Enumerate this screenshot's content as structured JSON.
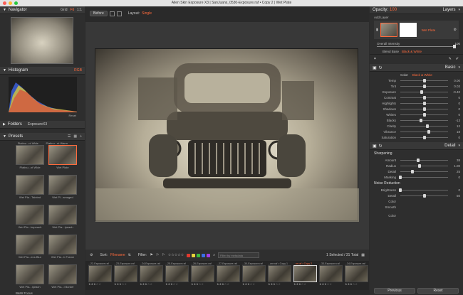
{
  "window": {
    "title": "Alien Skin Exposure X3 | SanJuans_0530-Exposure.raf • Copy 2 | Wet Plate"
  },
  "navigator": {
    "title": "Navigator",
    "grid": "Grid",
    "fit": "Fit",
    "ratio": "1:1"
  },
  "histogram": {
    "title": "Histogram",
    "mode": "RGB",
    "reset": "Reset"
  },
  "folders": {
    "title": "Folders",
    "current": "ExposureX3"
  },
  "presets": {
    "title": "Presets",
    "items": [
      {
        "label": "Platinu...nt Wide",
        "selected": false
      },
      {
        "label": "Wet Plate",
        "selected": true
      },
      {
        "label": "Wet Pla...Tainted",
        "selected": false
      },
      {
        "label": "Wet Pl...amaged",
        "selected": false
      },
      {
        "label": "Wet Pla...Impeach",
        "selected": false
      },
      {
        "label": "Wet Pla...Ipeach",
        "selected": false
      },
      {
        "label": "Wet Pla...ens Blur",
        "selected": false
      },
      {
        "label": "Wet Pla...h Frame",
        "selected": false
      },
      {
        "label": "Wet Pla...Ipeach",
        "selected": false
      },
      {
        "label": "Wet Pla...l Border",
        "selected": false
      }
    ],
    "top_labels": [
      "Platinu...nt Wide",
      "Platinu...nt Warm"
    ],
    "group": "B&W Focus"
  },
  "toolbar": {
    "before": "Before",
    "layout_label": "Layout:",
    "layout_value": "Single"
  },
  "filterbar": {
    "sort_label": "Sort:",
    "sort_value": "Filename",
    "filter_label": "Filter:",
    "search_placeholder": "Filter by metadata",
    "selection": "1 Selected / 31 Total",
    "colors": [
      "#e23a2e",
      "#e8d43a",
      "#3bbd3b",
      "#3b6ee8",
      "#a43be8"
    ]
  },
  "filmstrip": [
    {
      "label": "...22-Exposure.raf"
    },
    {
      "label": "...23-Exposure.raf"
    },
    {
      "label": "...24-Exposure.raf"
    },
    {
      "label": "...25-Exposure.raf"
    },
    {
      "label": "...26-Exposure.raf"
    },
    {
      "label": "...27-Exposure.raf"
    },
    {
      "label": "...30-Exposure.raf"
    },
    {
      "label": "...ure.raf • Copy 1"
    },
    {
      "label": "...re.raf • Copy 2"
    },
    {
      "label": "...33-Exposure.raf"
    },
    {
      "label": "...34-Exposure.raf"
    }
  ],
  "layers": {
    "opacity_label": "Opacity:",
    "opacity_value": "100",
    "title": "Layers",
    "add_layer": "Add Layer",
    "layer_name": "Wet Plate",
    "overall_intensity_label": "Overall Intensity",
    "overall_intensity_value": "100",
    "blend_label": "Blend Base",
    "blend_value": "Black & White"
  },
  "basic": {
    "title": "Basic",
    "tab_color": "Color",
    "tab_bw": "Black & White",
    "sliders": [
      {
        "label": "Temp",
        "value": "0.00",
        "pos": 0.5
      },
      {
        "label": "Tint",
        "value": "0.03",
        "pos": 0.5
      },
      {
        "label": "Exposure",
        "value": "-0.40",
        "pos": 0.45
      },
      {
        "label": "Contrast",
        "value": "0",
        "pos": 0.5
      },
      {
        "label": "Highlights",
        "value": "0",
        "pos": 0.5
      },
      {
        "label": "Shadows",
        "value": "0",
        "pos": 0.5
      },
      {
        "label": "Whites",
        "value": "0",
        "pos": 0.5
      },
      {
        "label": "Blacks",
        "value": "-13",
        "pos": 0.44
      },
      {
        "label": "Clarity",
        "value": "12",
        "pos": 0.56
      },
      {
        "label": "Vibrance",
        "value": "18",
        "pos": 0.59
      },
      {
        "label": "Saturation",
        "value": "0",
        "pos": 0.5
      }
    ]
  },
  "detail": {
    "title": "Detail",
    "sharpening": "Sharpening",
    "sharp_sliders": [
      {
        "label": "Amount",
        "value": "38",
        "pos": 0.38
      },
      {
        "label": "Radius",
        "value": "1.00",
        "pos": 0.4
      },
      {
        "label": "Detail",
        "value": "25",
        "pos": 0.25
      },
      {
        "label": "Masking",
        "value": "0",
        "pos": 0.0
      }
    ],
    "noise": "Noise Reduction",
    "noise_sliders": [
      {
        "label": "Brightness",
        "value": "0",
        "pos": 0.0
      },
      {
        "label": "Detail",
        "value": "50",
        "pos": 0.5
      }
    ],
    "color_label": "Color",
    "smooth_label": "Smooth",
    "color2_label": "Color"
  },
  "footer": {
    "previous": "Previous",
    "reset": "Reset"
  }
}
